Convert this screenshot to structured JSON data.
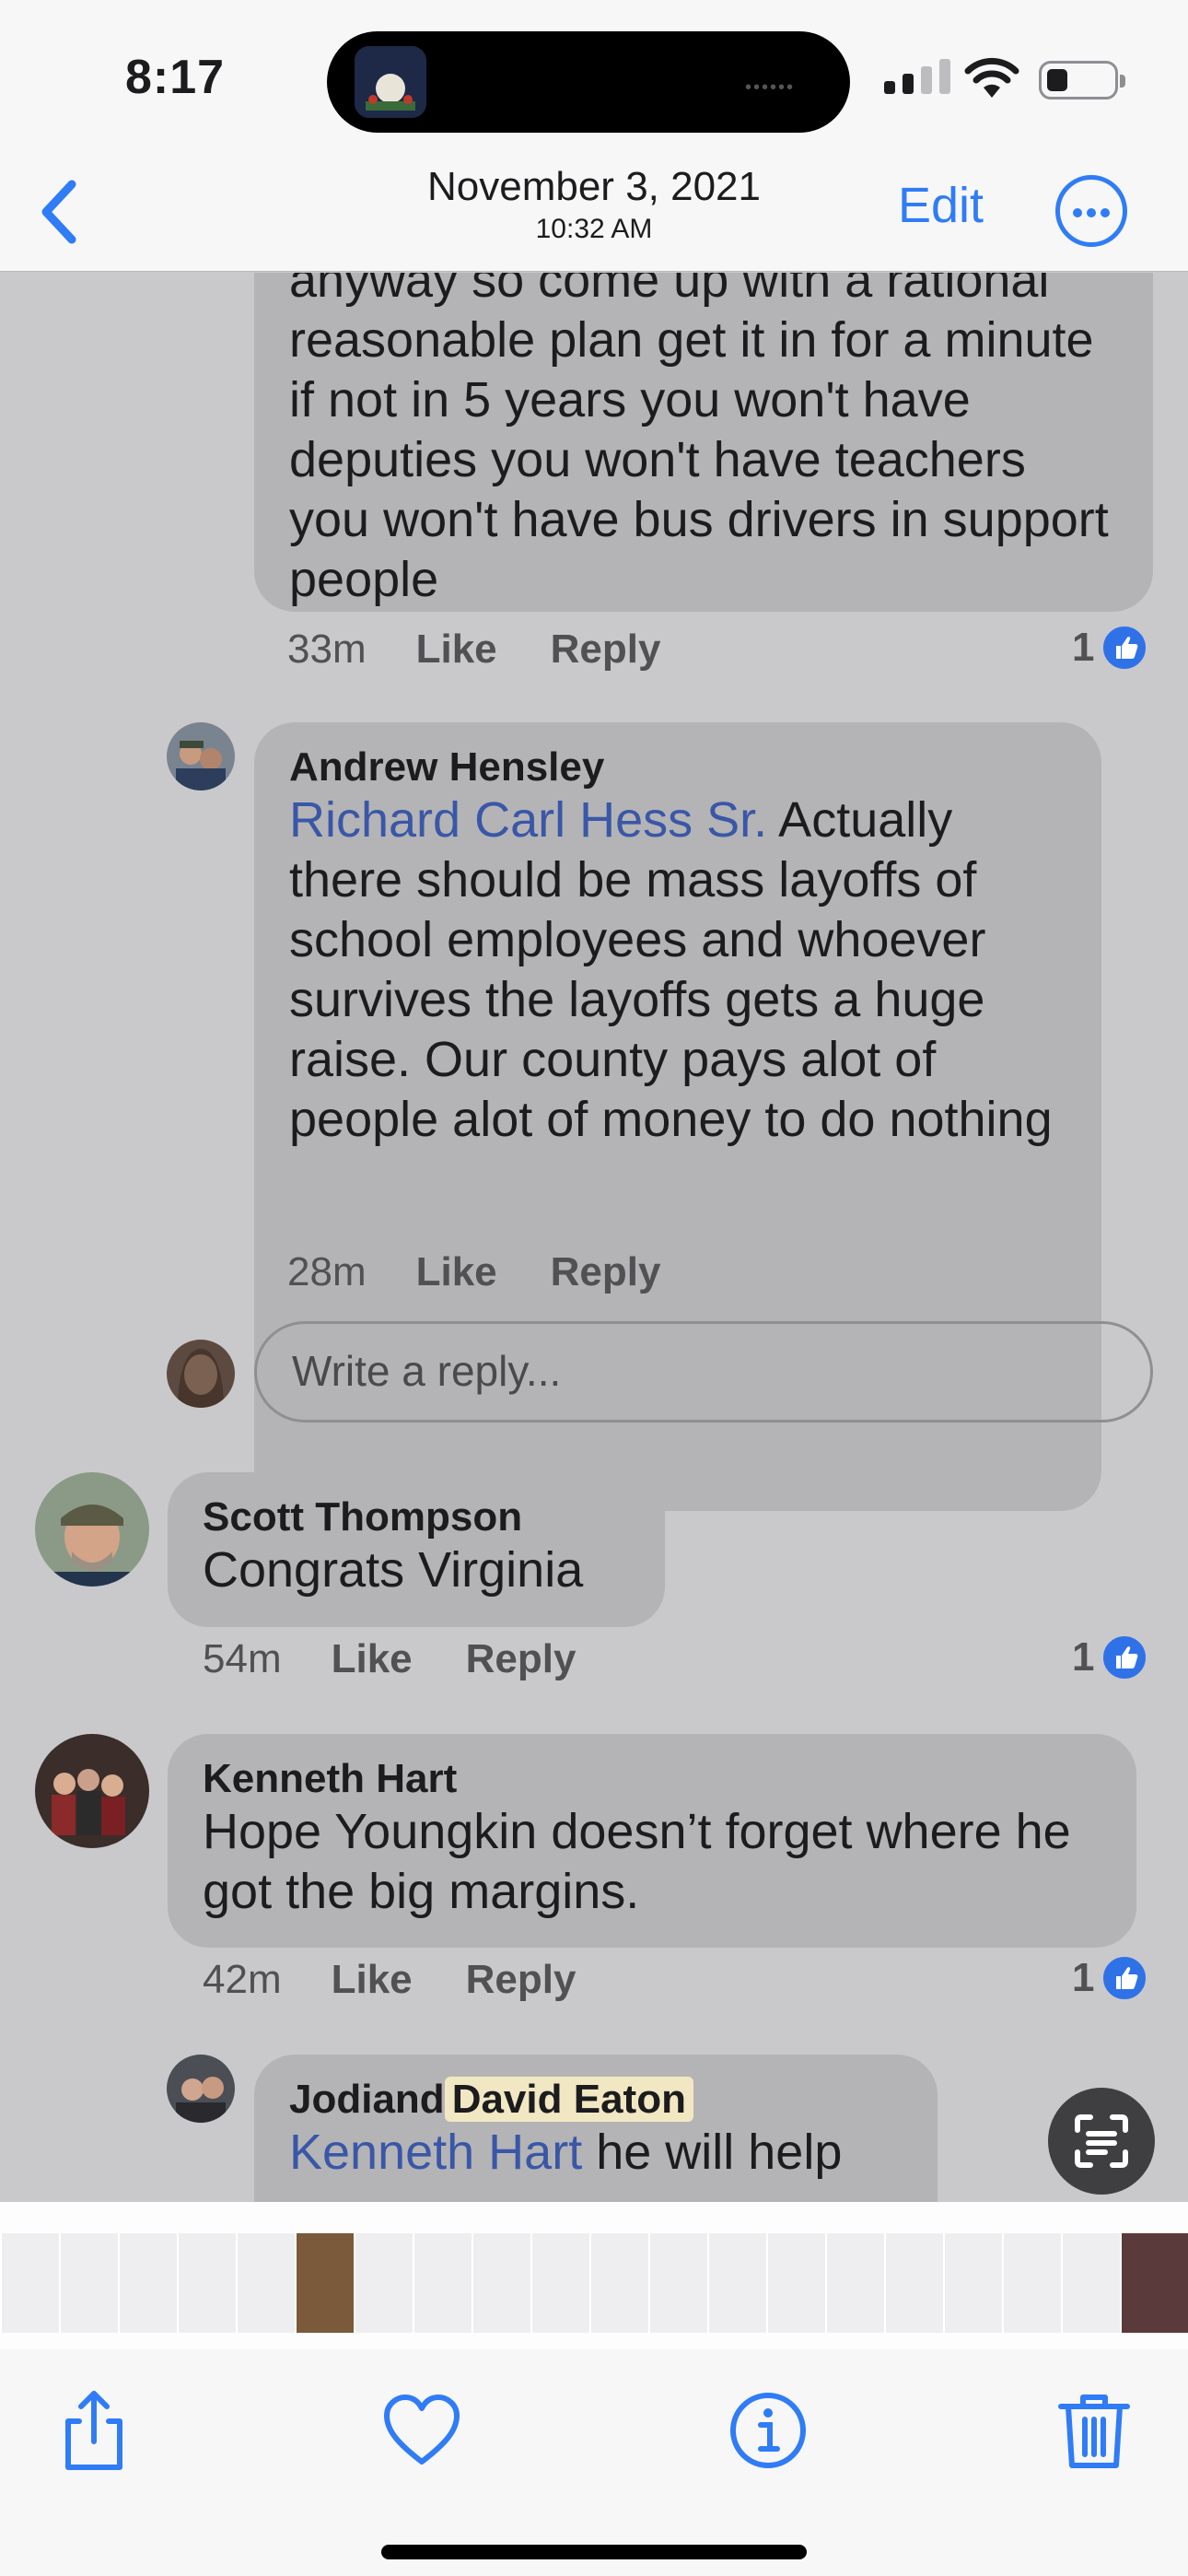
{
  "status_bar": {
    "time": "8:17"
  },
  "nav": {
    "date": "November 3, 2021",
    "time": "10:32 AM",
    "edit_label": "Edit"
  },
  "comments": {
    "c1": {
      "text": "anyway so come up with a rational reasonable plan get it in for a minute if not in 5 years you won't have deputies you won't have teachers you won't have bus drivers in support people",
      "time": "33m",
      "like": "Like",
      "reply": "Reply",
      "likes": "1"
    },
    "c2": {
      "author": "Andrew Hensley",
      "mention": "Richard Carl Hess Sr.",
      "text": " Actually there should be mass layoffs of school employees and whoever survives the layoffs gets a huge raise. Our county pays alot of people alot of money to do nothing",
      "time": "28m",
      "like": "Like",
      "reply": "Reply"
    },
    "reply_input": {
      "placeholder": "Write a reply..."
    },
    "c3": {
      "author": "Scott Thompson",
      "text": "Congrats Virginia",
      "time": "54m",
      "like": "Like",
      "reply": "Reply",
      "likes": "1"
    },
    "c4": {
      "author": "Kenneth Hart",
      "text": "Hope Youngkin doesn’t forget where he got the big margins.",
      "time": "42m",
      "like": "Like",
      "reply": "Reply",
      "likes": "1"
    },
    "c5": {
      "author_a": "Jodiand",
      "author_b": "David Eaton",
      "mention": "Kenneth Hart",
      "text": " he will help"
    }
  },
  "colors": {
    "accent": "#2f7cf6",
    "mention": "#3a57a7",
    "bubble": "#b4b4b6",
    "like_badge": "#2f72e8"
  },
  "icons": [
    "back-chevron-icon",
    "more-options-icon",
    "share-icon",
    "heart-icon",
    "info-icon",
    "trash-icon",
    "live-text-icon"
  ]
}
